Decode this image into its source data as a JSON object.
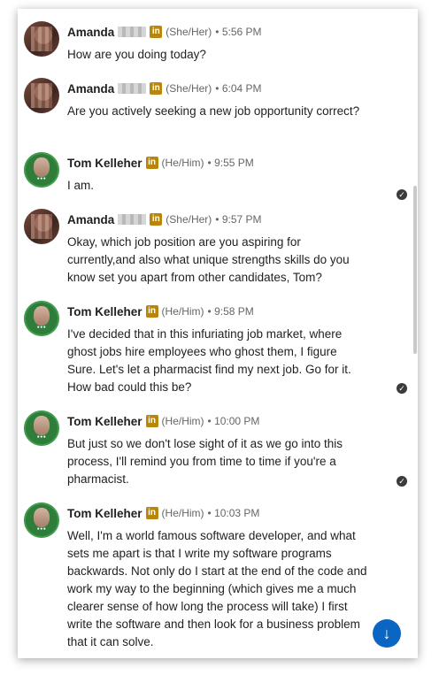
{
  "messages": [
    {
      "sender": "Amanda",
      "pronouns": "(She/Her)",
      "time": "• 5:56 PM",
      "text": "How are you doing today?",
      "avatar": "amanda",
      "redacted": true,
      "seen": false
    },
    {
      "sender": "Amanda",
      "pronouns": "(She/Her)",
      "time": "• 6:04 PM",
      "text": "Are you actively seeking a new job opportunity correct?",
      "avatar": "amanda",
      "redacted": true,
      "seen": false
    },
    {
      "sender": "Tom Kelleher",
      "pronouns": "(He/Him)",
      "time": "• 9:55 PM",
      "text": "I am.",
      "avatar": "tom",
      "redacted": false,
      "seen": true
    },
    {
      "sender": "Amanda",
      "pronouns": "(She/Her)",
      "time": "• 9:57 PM",
      "text": "Okay, which job position are you aspiring for currently,and also what unique strengths skills do you know set you apart from other candidates, Tom?",
      "avatar": "amanda",
      "redacted": true,
      "seen": false
    },
    {
      "sender": "Tom Kelleher",
      "pronouns": "(He/Him)",
      "time": "• 9:58 PM",
      "text": "I've decided that in this infuriating job market, where ghost jobs hire employees who ghost them, I figure Sure. Let's let a pharmacist find my next job. Go for it. How bad could this be?",
      "avatar": "tom",
      "redacted": false,
      "seen": true
    },
    {
      "sender": "Tom Kelleher",
      "pronouns": "(He/Him)",
      "time": "• 10:00 PM",
      "text": "But just so we don't lose sight of it as we go into this process, I'll remind you from time to time if you're a pharmacist.",
      "avatar": "tom",
      "redacted": false,
      "seen": true
    },
    {
      "sender": "Tom Kelleher",
      "pronouns": "(He/Him)",
      "time": "• 10:03 PM",
      "text": "Well, I'm a world famous software developer, and what sets me apart is that I write my software programs backwards. Not only do I start at the end of the code and work my way to the beginning (which gives me a much clearer sense of how long the process will take) I first write the software and then look for a business problem that it can solve.",
      "avatar": "tom",
      "redacted": false,
      "seen": false
    }
  ],
  "linkedin_badge": "in",
  "icons": {
    "seen": "check-circle-icon",
    "scroll_down": "arrow-down-icon"
  },
  "colors": {
    "linkedin_gold": "#b8860b",
    "accent": "#0a66c2"
  }
}
